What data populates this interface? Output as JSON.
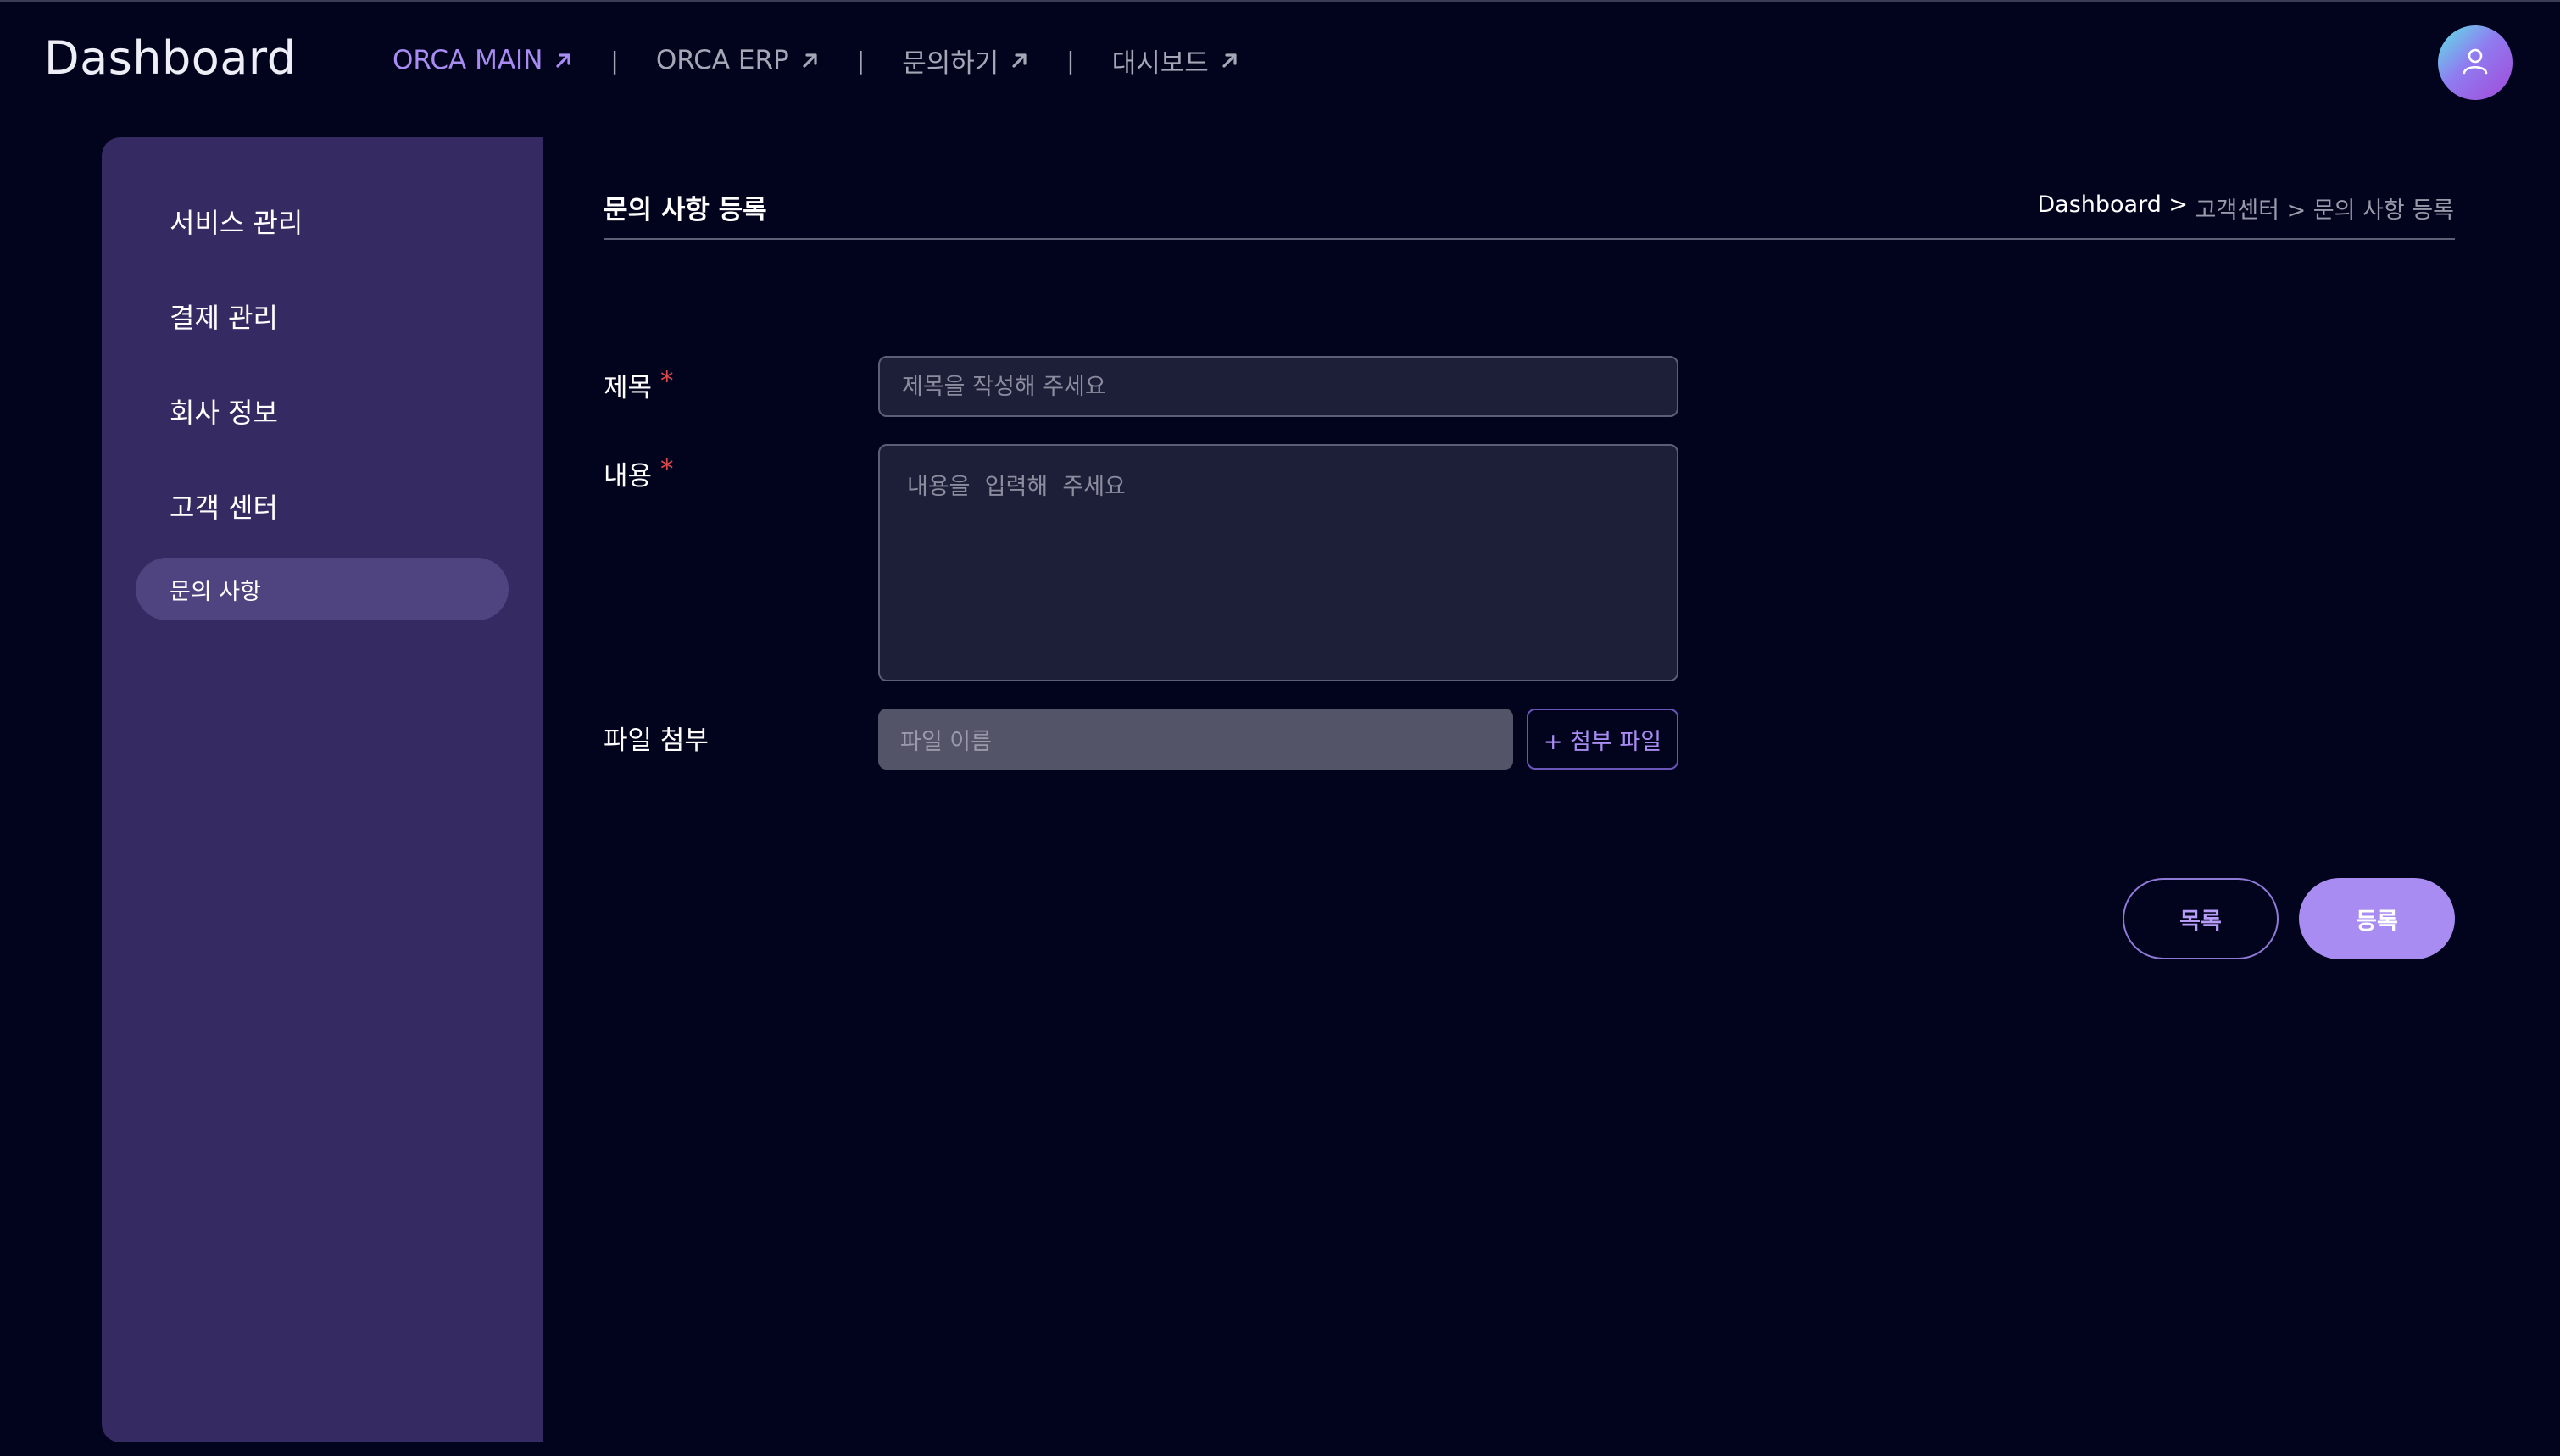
{
  "header": {
    "brand": "Dashboard",
    "nav": [
      {
        "label": "ORCA MAIN",
        "icon": "arrow-up-right-icon",
        "active": true
      },
      {
        "label": "ORCA ERP",
        "icon": "arrow-up-right-icon",
        "active": false
      },
      {
        "label": "문의하기",
        "icon": "arrow-up-right-icon",
        "active": false
      },
      {
        "label": "대시보드",
        "icon": "arrow-up-right-icon",
        "active": false
      }
    ],
    "separator": "|",
    "avatar_icon": "user-icon"
  },
  "sidebar": {
    "items": [
      {
        "label": "서비스 관리"
      },
      {
        "label": "결제 관리"
      },
      {
        "label": "회사 정보"
      },
      {
        "label": "고객 센터"
      }
    ],
    "sub_items": [
      {
        "label": "문의 사항",
        "selected": true
      }
    ]
  },
  "main": {
    "page_title": "문의 사항 등록",
    "breadcrumb": {
      "root": "Dashboard >",
      "rest": " 고객센터 > 문의 사항 등록"
    },
    "form": {
      "title_label": "제목",
      "title_placeholder": "제목을 작성해 주세요",
      "content_label": "내용",
      "content_placeholder": "내용을  입력해  주세요",
      "required_mark": "*",
      "file_label": "파일 첨부",
      "file_name_placeholder": "파일 이름",
      "attach_button": "+ 첨부 파일"
    },
    "actions": {
      "list_button": "목록",
      "submit_button": "등록"
    }
  },
  "colors": {
    "background": "#02031d",
    "sidebar": "#352b62",
    "accent": "#a88cf2",
    "required": "#e0484c"
  }
}
